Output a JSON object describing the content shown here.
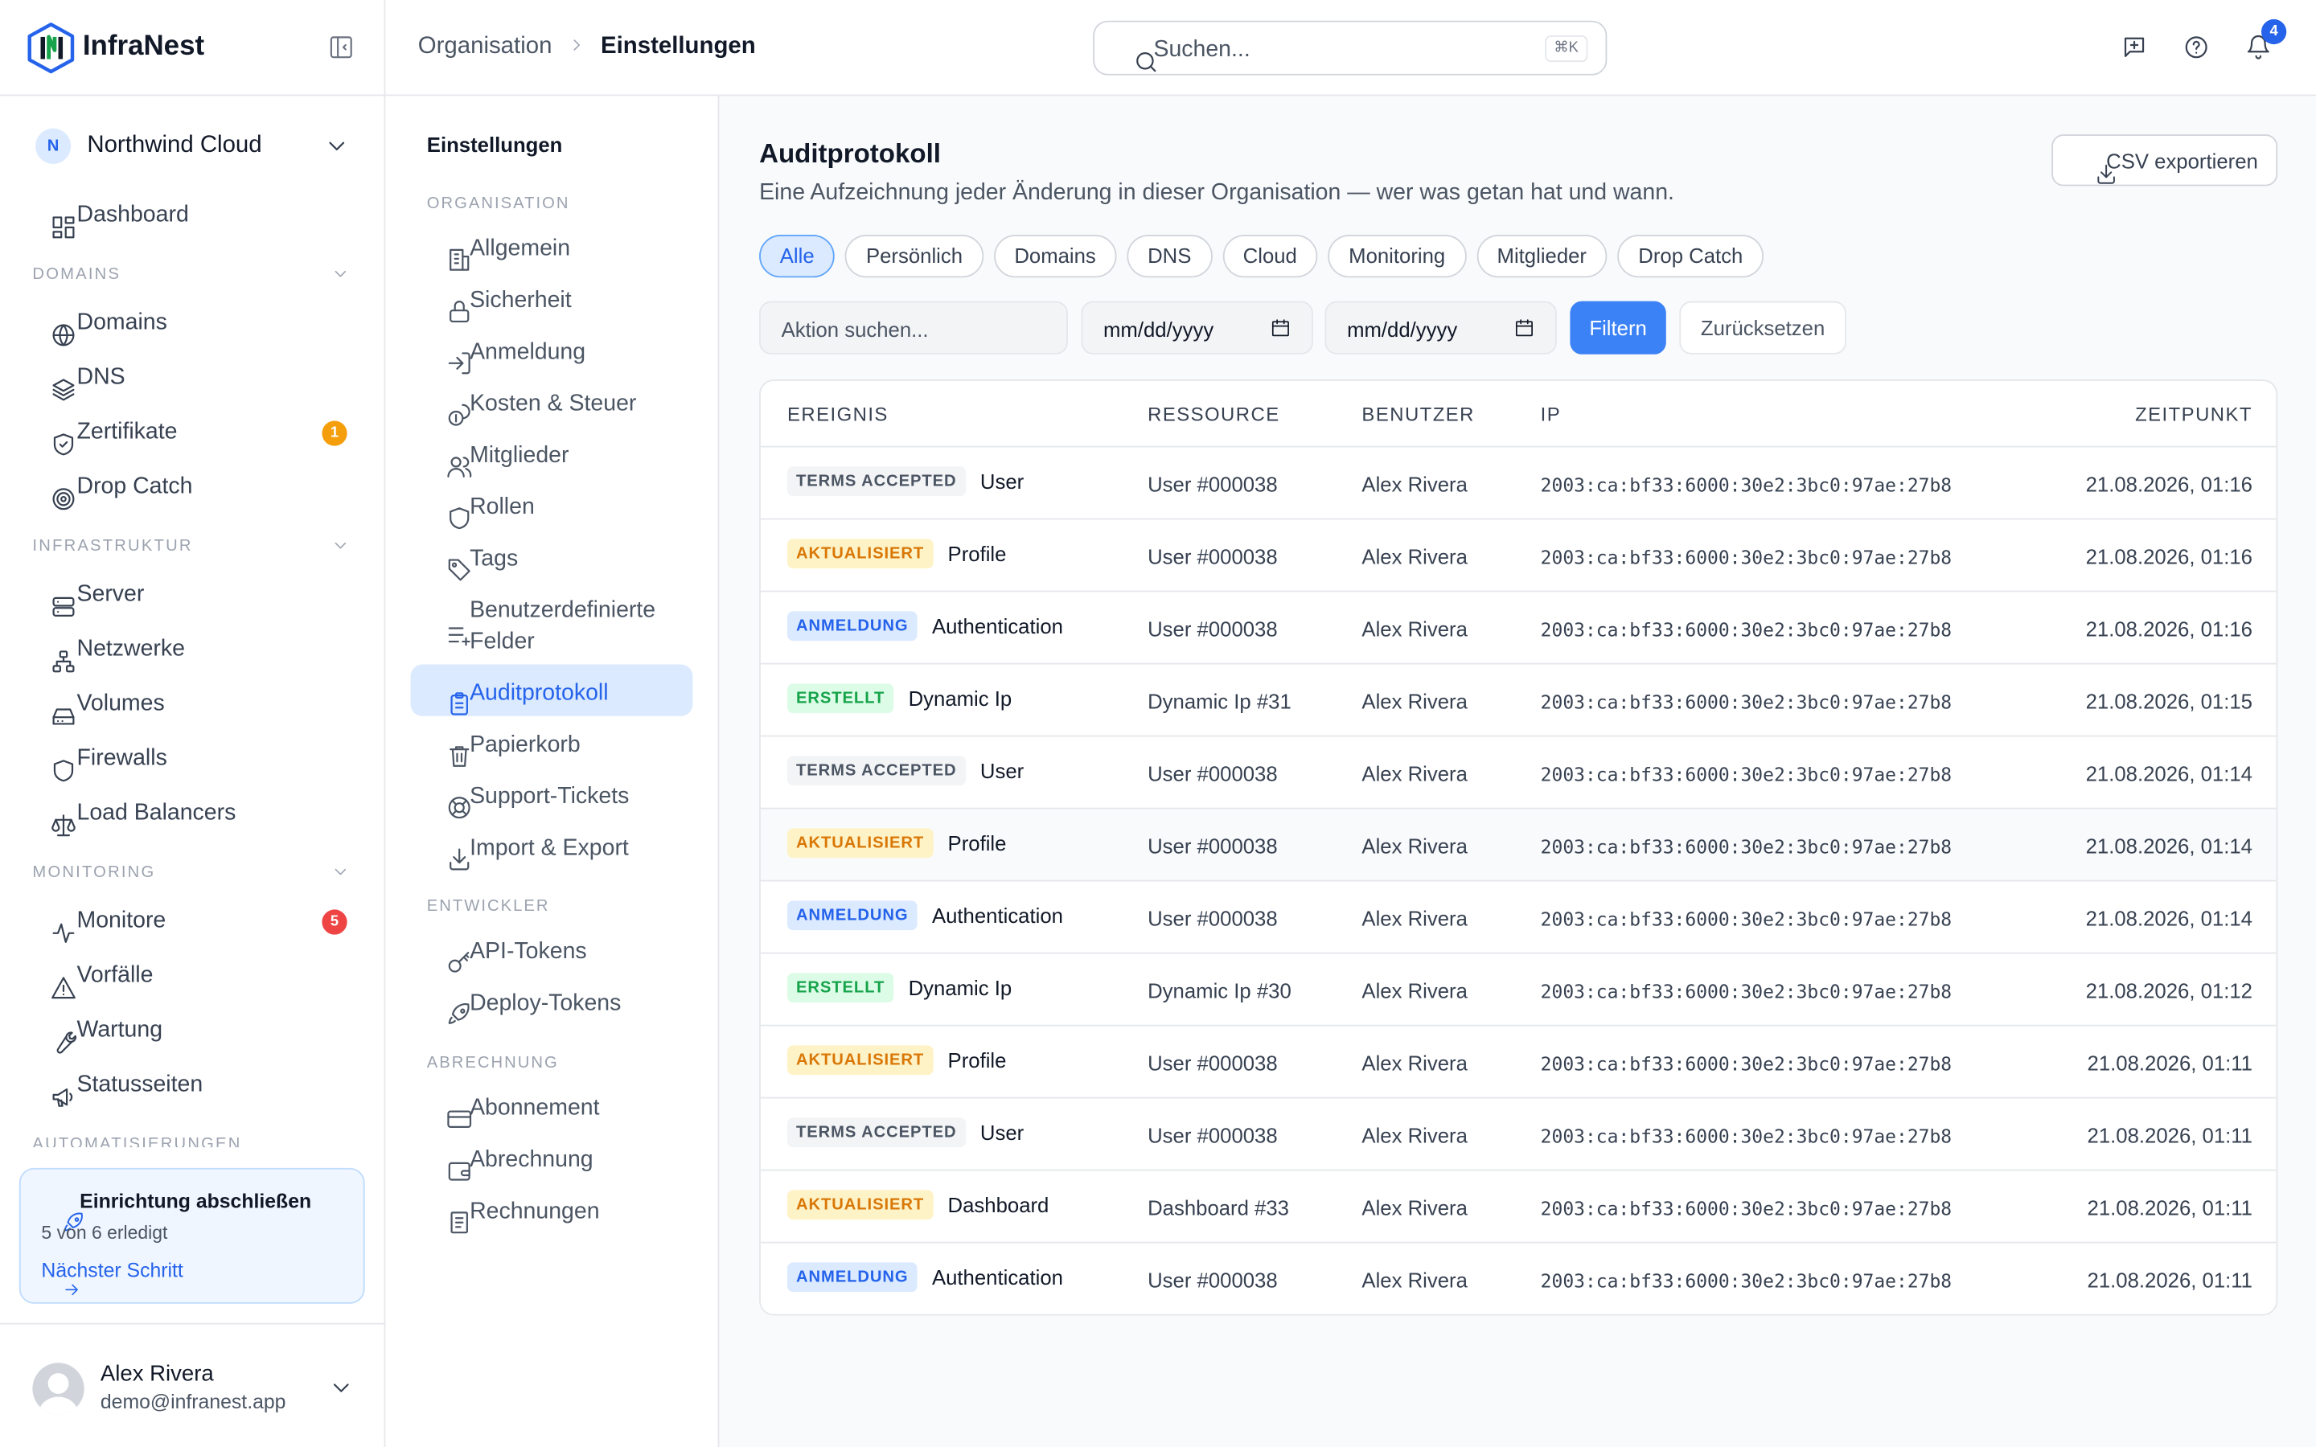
{
  "brand": {
    "name": "InfraNest"
  },
  "org": {
    "initial": "N",
    "name": "Northwind Cloud"
  },
  "nav": {
    "dashboard": "Dashboard",
    "sections": {
      "domains": "DOMAINS",
      "infra": "INFRASTRUKTUR",
      "monitoring": "MONITORING",
      "automation": "AUTOMATISIERUNGEN"
    },
    "items": {
      "domains": "Domains",
      "dns": "DNS",
      "certs": "Zertifikate",
      "certs_badge": "1",
      "dropcatch": "Drop Catch",
      "server": "Server",
      "networks": "Netzwerke",
      "volumes": "Volumes",
      "firewalls": "Firewalls",
      "lb": "Load Balancers",
      "monitors": "Monitore",
      "monitors_badge": "5",
      "incidents": "Vorfälle",
      "maintenance": "Wartung",
      "status": "Statusseiten"
    }
  },
  "setup": {
    "title": "Einrichtung abschließen",
    "progress": "5 von 6 erledigt",
    "next": "Nächster Schritt"
  },
  "user": {
    "name": "Alex Rivera",
    "email": "demo@infranest.app"
  },
  "breadcrumb": {
    "parent": "Organisation",
    "current": "Einstellungen"
  },
  "search": {
    "placeholder": "Suchen...",
    "shortcut": "⌘K"
  },
  "notifications": {
    "count": "4"
  },
  "settings_nav": {
    "title": "Einstellungen",
    "sections": {
      "org": "ORGANISATION",
      "dev": "ENTWICKLER",
      "billing": "ABRECHNUNG"
    },
    "items": {
      "general": "Allgemein",
      "security": "Sicherheit",
      "login": "Anmeldung",
      "costs": "Kosten & Steuer",
      "members": "Mitglieder",
      "roles": "Rollen",
      "tags": "Tags",
      "custom_fields": "Benutzerdefinierte Felder",
      "audit": "Auditprotokoll",
      "trash": "Papierkorb",
      "support": "Support-Tickets",
      "import_export": "Import & Export",
      "api_tokens": "API-Tokens",
      "deploy_tokens": "Deploy-Tokens",
      "subscription": "Abonnement",
      "billing": "Abrechnung",
      "invoices": "Rechnungen"
    }
  },
  "page": {
    "title": "Auditprotokoll",
    "subtitle": "Eine Aufzeichnung jeder Änderung in dieser Organisation — wer was getan hat und wann.",
    "export": "CSV exportieren"
  },
  "filters": {
    "chips": [
      "Alle",
      "Persönlich",
      "Domains",
      "DNS",
      "Cloud",
      "Monitoring",
      "Mitglieder",
      "Drop Catch"
    ],
    "search_placeholder": "Aktion suchen...",
    "date_from": "mm/dd/yyyy",
    "date_to": "mm/dd/yyyy",
    "apply": "Filtern",
    "reset": "Zurücksetzen"
  },
  "table": {
    "headers": {
      "event": "EREIGNIS",
      "resource": "RESSOURCE",
      "user": "BENUTZER",
      "ip": "IP",
      "time": "ZEITPUNKT"
    },
    "rows": [
      {
        "tag": "TERMS ACCEPTED",
        "kind": "terms",
        "event": "User",
        "resource": "User #000038",
        "user": "Alex Rivera",
        "ip": "2003:ca:bf33:6000:30e2:3bc0:97ae:27b8",
        "time": "21.08.2026, 01:16"
      },
      {
        "tag": "AKTUALISIERT",
        "kind": "upd",
        "event": "Profile",
        "resource": "User #000038",
        "user": "Alex Rivera",
        "ip": "2003:ca:bf33:6000:30e2:3bc0:97ae:27b8",
        "time": "21.08.2026, 01:16"
      },
      {
        "tag": "ANMELDUNG",
        "kind": "login",
        "event": "Authentication",
        "resource": "User #000038",
        "user": "Alex Rivera",
        "ip": "2003:ca:bf33:6000:30e2:3bc0:97ae:27b8",
        "time": "21.08.2026, 01:16"
      },
      {
        "tag": "ERSTELLT",
        "kind": "new",
        "event": "Dynamic Ip",
        "resource": "Dynamic Ip #31",
        "user": "Alex Rivera",
        "ip": "2003:ca:bf33:6000:30e2:3bc0:97ae:27b8",
        "time": "21.08.2026, 01:15"
      },
      {
        "tag": "TERMS ACCEPTED",
        "kind": "terms",
        "event": "User",
        "resource": "User #000038",
        "user": "Alex Rivera",
        "ip": "2003:ca:bf33:6000:30e2:3bc0:97ae:27b8",
        "time": "21.08.2026, 01:14"
      },
      {
        "tag": "AKTUALISIERT",
        "kind": "upd",
        "event": "Profile",
        "resource": "User #000038",
        "user": "Alex Rivera",
        "ip": "2003:ca:bf33:6000:30e2:3bc0:97ae:27b8",
        "time": "21.08.2026, 01:14"
      },
      {
        "tag": "ANMELDUNG",
        "kind": "login",
        "event": "Authentication",
        "resource": "User #000038",
        "user": "Alex Rivera",
        "ip": "2003:ca:bf33:6000:30e2:3bc0:97ae:27b8",
        "time": "21.08.2026, 01:14"
      },
      {
        "tag": "ERSTELLT",
        "kind": "new",
        "event": "Dynamic Ip",
        "resource": "Dynamic Ip #30",
        "user": "Alex Rivera",
        "ip": "2003:ca:bf33:6000:30e2:3bc0:97ae:27b8",
        "time": "21.08.2026, 01:12"
      },
      {
        "tag": "AKTUALISIERT",
        "kind": "upd",
        "event": "Profile",
        "resource": "User #000038",
        "user": "Alex Rivera",
        "ip": "2003:ca:bf33:6000:30e2:3bc0:97ae:27b8",
        "time": "21.08.2026, 01:11"
      },
      {
        "tag": "TERMS ACCEPTED",
        "kind": "terms",
        "event": "User",
        "resource": "User #000038",
        "user": "Alex Rivera",
        "ip": "2003:ca:bf33:6000:30e2:3bc0:97ae:27b8",
        "time": "21.08.2026, 01:11"
      },
      {
        "tag": "AKTUALISIERT",
        "kind": "upd",
        "event": "Dashboard",
        "resource": "Dashboard #33",
        "user": "Alex Rivera",
        "ip": "2003:ca:bf33:6000:30e2:3bc0:97ae:27b8",
        "time": "21.08.2026, 01:11"
      },
      {
        "tag": "ANMELDUNG",
        "kind": "login",
        "event": "Authentication",
        "resource": "User #000038",
        "user": "Alex Rivera",
        "ip": "2003:ca:bf33:6000:30e2:3bc0:97ae:27b8",
        "time": "21.08.2026, 01:11"
      }
    ]
  }
}
